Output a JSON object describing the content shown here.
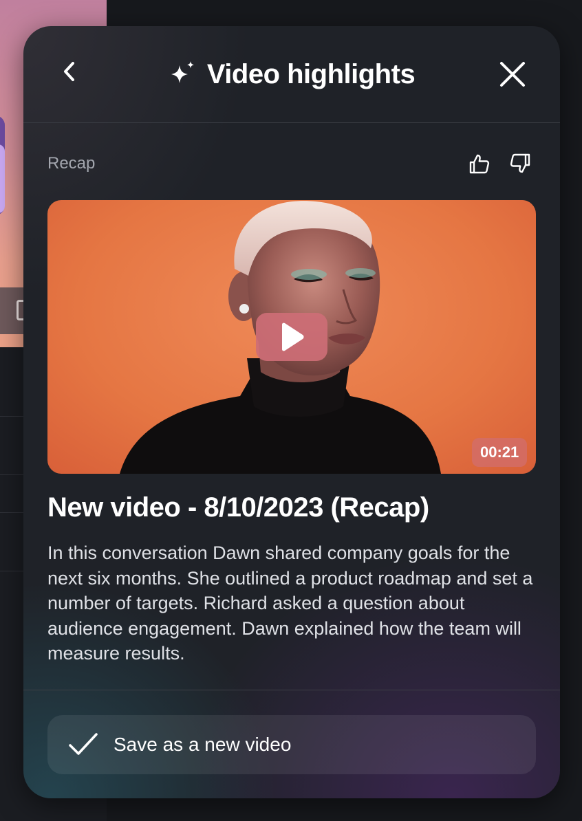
{
  "header": {
    "title": "Video highlights",
    "back_icon": "chevron-left-icon",
    "title_icon": "sparkle-icon",
    "close_icon": "close-icon"
  },
  "recap": {
    "section_label": "Recap",
    "like_icon": "thumbs-up-icon",
    "dislike_icon": "thumbs-down-icon"
  },
  "video": {
    "duration": "00:21",
    "play_icon": "play-icon",
    "title": "New video - 8/10/2023 (Recap)",
    "description": "In this conversation Dawn shared company goals for the next six months. She outlined a product roadmap and set a number of targets. Richard asked a question about audience engagement. Dawn explained how the team will measure results."
  },
  "actions": {
    "save_label": "Save as a new video",
    "save_icon": "checkmark-icon"
  },
  "colors": {
    "panel_bg": "#1f2228",
    "video_bg": "#e57643",
    "play_button": "#cd6e76",
    "text_primary": "#ffffff",
    "text_muted": "#a3a6ae"
  }
}
